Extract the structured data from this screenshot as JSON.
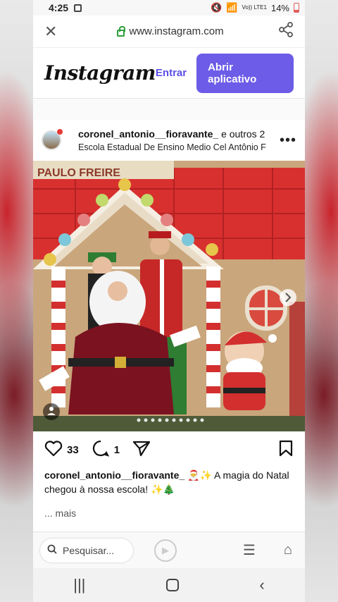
{
  "status": {
    "time": "4:25",
    "network": "Vo)) LTE1",
    "battery": "14%"
  },
  "browser": {
    "url": "www.instagram.com"
  },
  "header": {
    "logo": "Instagram",
    "login_label": "Entrar",
    "open_app_label": "Abrir aplicativo",
    "accent": "#6c5ce7"
  },
  "post": {
    "username": "coronel_antonio__fioravante_",
    "others": "e outros 2",
    "location": "Escola Estadual De Ensino Medio Cel Antônio F",
    "photo_sign": "PAULO FREIRE",
    "likes": "33",
    "comments": "1",
    "caption_user": "coronel_antonio__fioravante_",
    "caption_text": "🎅✨ A magia do Natal chegou à nossa escola! ✨🎄",
    "more_label": "... mais"
  },
  "bottom": {
    "search_placeholder": "Pesquisar..."
  }
}
